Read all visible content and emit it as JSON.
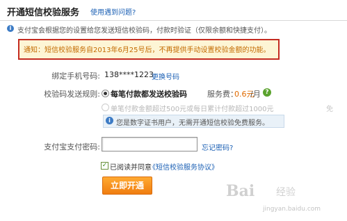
{
  "header": {
    "title": "开通短信校验服务",
    "help_link": "使用遇到问题?"
  },
  "info": {
    "icon": "info-icon",
    "text": "支付宝会根据您的设置给您发送短信校验码，付款时验证（仅限余额和快捷支付）。"
  },
  "notice": {
    "text": "通知：短信校验服务自2013年6月25号后，不再提供手动设置校验金额的功能。",
    "border_color": "#c42b20",
    "text_color": "#c46b00"
  },
  "form": {
    "phone_label": "绑定手机号码:",
    "phone_value": "138****1223",
    "change_phone_link": "更换号码",
    "rule_label": "校验码发送规则:",
    "option1_label": "每笔付款都发送校验码",
    "fee_label": "服务费：",
    "fee_price": "0.6元",
    "fee_unit": "/月",
    "help_icon": "question-icon",
    "option2_label": "单笔付款金额超过500元或每日累计付款超过1000元",
    "option2_extra": "免",
    "cert_icon": "info-icon",
    "cert_notice": "您是数字证书用户，无需开通短信校验免费服务。",
    "password_label": "支付宝支付密码:",
    "password_value": "",
    "forgot_password_link": "忘记密码?",
    "agree_checked": true,
    "agree_text": "已阅读并同意",
    "agreement_link": "《短信校验服务协议》",
    "submit_label": "立即开通"
  },
  "watermark": {
    "brand": "Bai",
    "sub": "经验",
    "url": "jingyan.baidu.com"
  },
  "colors": {
    "accent_orange": "#f07d10",
    "link_blue": "#1a5fb4",
    "price_orange": "#e06a00"
  }
}
